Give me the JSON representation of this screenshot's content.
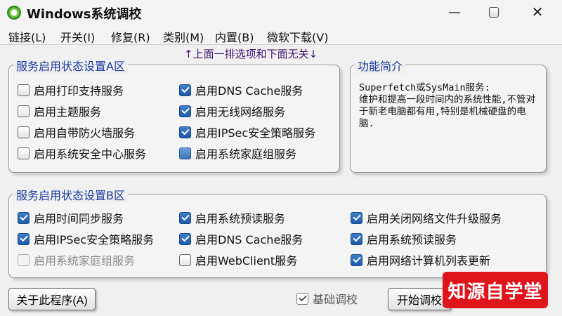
{
  "window": {
    "title": "Windows系统调校",
    "minimize": "—",
    "close": "✕"
  },
  "menu": [
    "链接(L)",
    "开关(I)",
    "修复(R)",
    "类别(M)",
    "内置(B)",
    "微软下载(V)"
  ],
  "hint": "↑上面一排选项和下面无关↓",
  "groupA": {
    "title": "服务启用状态设置A区",
    "items": [
      {
        "label": "启用打印支持服务",
        "state": "unchecked"
      },
      {
        "label": "启用主题服务",
        "state": "unchecked"
      },
      {
        "label": "启用自带防火墙服务",
        "state": "unchecked"
      },
      {
        "label": "启用系统安全中心服务",
        "state": "unchecked"
      },
      {
        "label": "启用DNS Cache服务",
        "state": "checked"
      },
      {
        "label": "启用无线网络服务",
        "state": "checked"
      },
      {
        "label": "启用IPSec安全策略服务",
        "state": "checked"
      },
      {
        "label": "启用系统家庭组服务",
        "state": "partial"
      }
    ]
  },
  "info": {
    "title": "功能简介",
    "text": "Superfetch或SysMain服务:\n维护和提高一段时间内的系统性能,不管对于新老电脑都有用,特别是机械硬盘的电脑."
  },
  "groupB": {
    "title": "服务启用状态设置B区",
    "items": [
      {
        "label": "启用时间同步服务",
        "state": "checked"
      },
      {
        "label": "启用IPSec安全策略服务",
        "state": "checked"
      },
      {
        "label": "启用系统家庭组服务",
        "state": "disabled"
      },
      {
        "label": "启用系统预读服务",
        "state": "checked"
      },
      {
        "label": "启用DNS Cache服务",
        "state": "checked"
      },
      {
        "label": "启用WebClient服务",
        "state": "unchecked"
      },
      {
        "label": "启用关闭网络文件升级服务",
        "state": "checked"
      },
      {
        "label": "启用系统预读服务",
        "state": "checked"
      },
      {
        "label": "启用网络计算机列表更新",
        "state": "checked"
      }
    ]
  },
  "footer": {
    "about_label": "关于此程序(A)",
    "basic_tune_label": "基础调校",
    "start_label": "开始调校"
  },
  "watermark": "知源自学堂",
  "colors": {
    "accent": "#1e5aa8",
    "group_title": "#1a3a9e",
    "hint": "#3d1470",
    "watermark": "#e0141b"
  }
}
